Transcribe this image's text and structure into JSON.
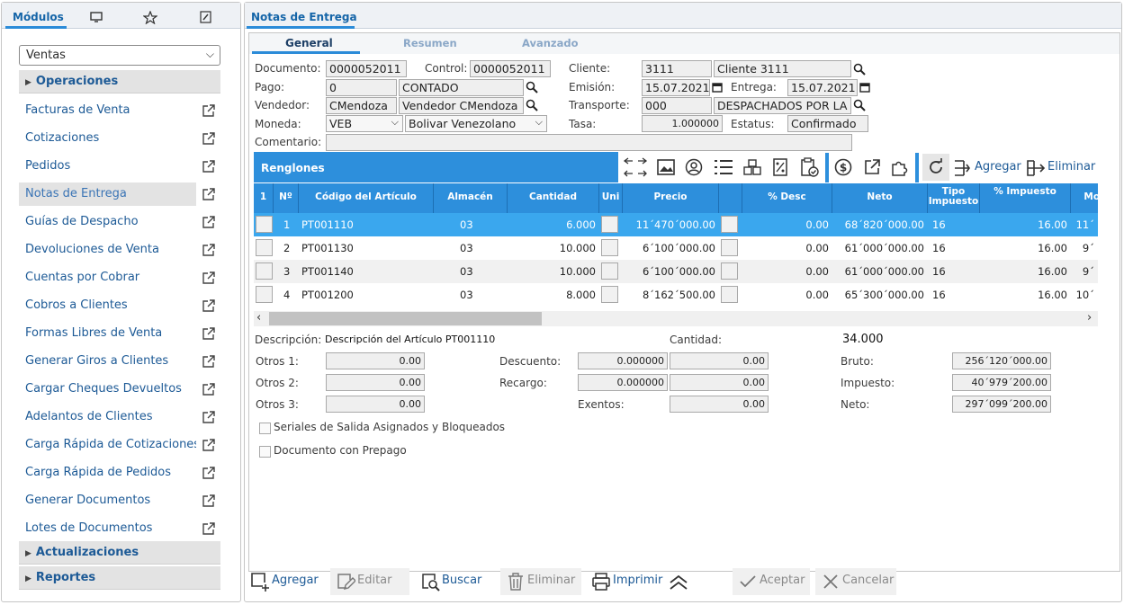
{
  "left": {
    "tab_label": "Módulos",
    "select_value": "Ventas",
    "sections": {
      "operaciones": "Operaciones",
      "actualizaciones": "Actualizaciones",
      "reportes": "Reportes"
    },
    "items": [
      "Facturas de Venta",
      "Cotizaciones",
      "Pedidos",
      "Notas de Entrega",
      "Guías de Despacho",
      "Devoluciones de Venta",
      "Cuentas por Cobrar",
      "Cobros a Clientes",
      "Formas Libres de Venta",
      "Generar Giros a Clientes",
      "Cargar Cheques Devueltos",
      "Adelantos de Clientes",
      "Carga Rápida de Cotizaciones",
      "Carga Rápida de Pedidos",
      "Generar Documentos",
      "Lotes de Documentos"
    ]
  },
  "window": {
    "title": "Notas de Entrega",
    "tabs": [
      "General",
      "Resumen",
      "Avanzado"
    ]
  },
  "form": {
    "documento_label": "Documento:",
    "documento": "0000052011",
    "control_label": "Control:",
    "control": "0000052011",
    "cliente_label": "Cliente:",
    "cliente_code": "3111",
    "cliente_name": "Cliente 3111",
    "pago_label": "Pago:",
    "pago_code": "0",
    "pago_name": "CONTADO",
    "emision_label": "Emisión:",
    "emision": "15.07.2021",
    "entrega_label": "Entrega:",
    "entrega": "15.07.2021",
    "vendedor_label": "Vendedor:",
    "vendedor_code": "CMendoza",
    "vendedor_name": "Vendedor CMendoza",
    "transporte_label": "Transporte:",
    "transporte_code": "000",
    "transporte_name": "DESPACHADOS POR LA",
    "moneda_label": "Moneda:",
    "moneda_code": "VEB",
    "moneda_name": "Bolivar Venezolano",
    "tasa_label": "Tasa:",
    "tasa": "1.000000",
    "estatus_label": "Estatus:",
    "estatus": "Confirmado",
    "comentario_label": "Comentario:",
    "comentario": ""
  },
  "renglones": {
    "title": "Renglones",
    "agregar": "Agregar",
    "eliminar": "Eliminar"
  },
  "table": {
    "headers": [
      "1",
      "Nº",
      "Código del Artículo",
      "Almacén",
      "Cantidad",
      "Uni",
      "Precio",
      "",
      "% Desc",
      "Neto",
      "Tipo Impuesto",
      "% Impuesto",
      "Mont"
    ],
    "rows": [
      {
        "n": "1",
        "codigo": "PT001110",
        "almacen": "03",
        "cantidad": "6.000",
        "precio": "11´470´000.00",
        "desc": "0.00",
        "neto": "68´820´000.00",
        "tipo": "16",
        "imp": "16.00",
        "mont": "11´"
      },
      {
        "n": "2",
        "codigo": "PT001130",
        "almacen": "03",
        "cantidad": "10.000",
        "precio": "6´100´000.00",
        "desc": "0.00",
        "neto": "61´000´000.00",
        "tipo": "16",
        "imp": "16.00",
        "mont": "9´"
      },
      {
        "n": "3",
        "codigo": "PT001140",
        "almacen": "03",
        "cantidad": "10.000",
        "precio": "6´100´000.00",
        "desc": "0.00",
        "neto": "61´000´000.00",
        "tipo": "16",
        "imp": "16.00",
        "mont": "9´"
      },
      {
        "n": "4",
        "codigo": "PT001200",
        "almacen": "03",
        "cantidad": "8.000",
        "precio": "8´162´500.00",
        "desc": "0.00",
        "neto": "65´300´000.00",
        "tipo": "16",
        "imp": "16.00",
        "mont": "10´"
      }
    ]
  },
  "summary": {
    "descripcion_label": "Descripción:",
    "descripcion": "Descripción del Artículo PT001110",
    "cantidad_label": "Cantidad:",
    "cantidad": "34.000",
    "otros1_label": "Otros 1:",
    "otros1": "0.00",
    "otros2_label": "Otros 2:",
    "otros2": "0.00",
    "otros3_label": "Otros 3:",
    "otros3": "0.00",
    "descuento_label": "Descuento:",
    "descuento_pct": "0.000000",
    "descuento": "0.00",
    "recargo_label": "Recargo:",
    "recargo_pct": "0.000000",
    "recargo": "0.00",
    "exentos_label": "Exentos:",
    "exentos": "0.00",
    "bruto_label": "Bruto:",
    "bruto": "256´120´000.00",
    "impuesto_label": "Impuesto:",
    "impuesto": "40´979´200.00",
    "neto_label": "Neto:",
    "neto": "297´099´200.00",
    "chk1": "Seriales de Salida Asignados y Bloqueados",
    "chk2": "Documento con Prepago"
  },
  "bottom": {
    "agregar": "Agregar",
    "editar": "Editar",
    "buscar": "Buscar",
    "eliminar": "Eliminar",
    "imprimir": "Imprimir",
    "aceptar": "Aceptar",
    "cancelar": "Cancelar"
  },
  "colors": {
    "accent": "#2d8fdc",
    "selected_row": "#3aa7ee",
    "link": "#1d5a96"
  }
}
